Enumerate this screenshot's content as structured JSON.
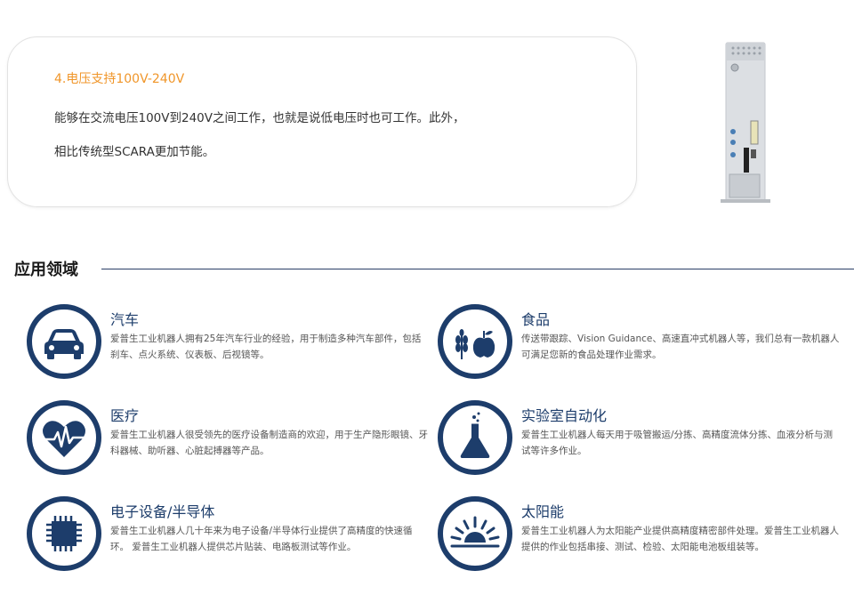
{
  "feature": {
    "title": "4.电压支持100V-240V",
    "line1": "能够在交流电压100V到240V之间工作，也就是说低电压时也可工作。此外，",
    "line2": "相比传统型SCARA更加节能。"
  },
  "section": {
    "title": "应用领域"
  },
  "colors": {
    "accent": "#f0962a",
    "navy": "#1d3d6b",
    "divider": "#2a3f66"
  },
  "applications": [
    {
      "icon": "car-icon",
      "name": "汽车",
      "desc": "爱普生工业机器人拥有25年汽车行业的经验，用于制造多种汽车部件，包括刹车、点火系统、仪表板、后视镜等。"
    },
    {
      "icon": "wheat-apple-icon",
      "name": "食品",
      "desc": "传送带跟踪、Vision Guidance、高速直冲式机器人等，我们总有一款机器人可满足您新的食品处理作业需求。"
    },
    {
      "icon": "heart-pulse-icon",
      "name": "医疗",
      "desc": "爱普生工业机器人很受领先的医疗设备制造商的欢迎，用于生产隐形眼镜、牙科器械、助听器、心脏起搏器等产品。"
    },
    {
      "icon": "flask-icon",
      "name": "实验室自动化",
      "desc": "爱普生工业机器人每天用于吸管搬运/分拣、高精度流体分拣、血液分析与测试等许多作业。"
    },
    {
      "icon": "chip-icon",
      "name": "电子设备/半导体",
      "desc": "爱普生工业机器人几十年来为电子设备/半导体行业提供了高精度的快速循环。 爱普生工业机器人提供芯片贴装、电路板测试等作业。"
    },
    {
      "icon": "sun-icon",
      "name": "太阳能",
      "desc": "爱普生工业机器人为太阳能产业提供高精度精密部件处理。爱普生工业机器人提供的作业包括串接、测试、检验、太阳能电池板组装等。"
    }
  ]
}
